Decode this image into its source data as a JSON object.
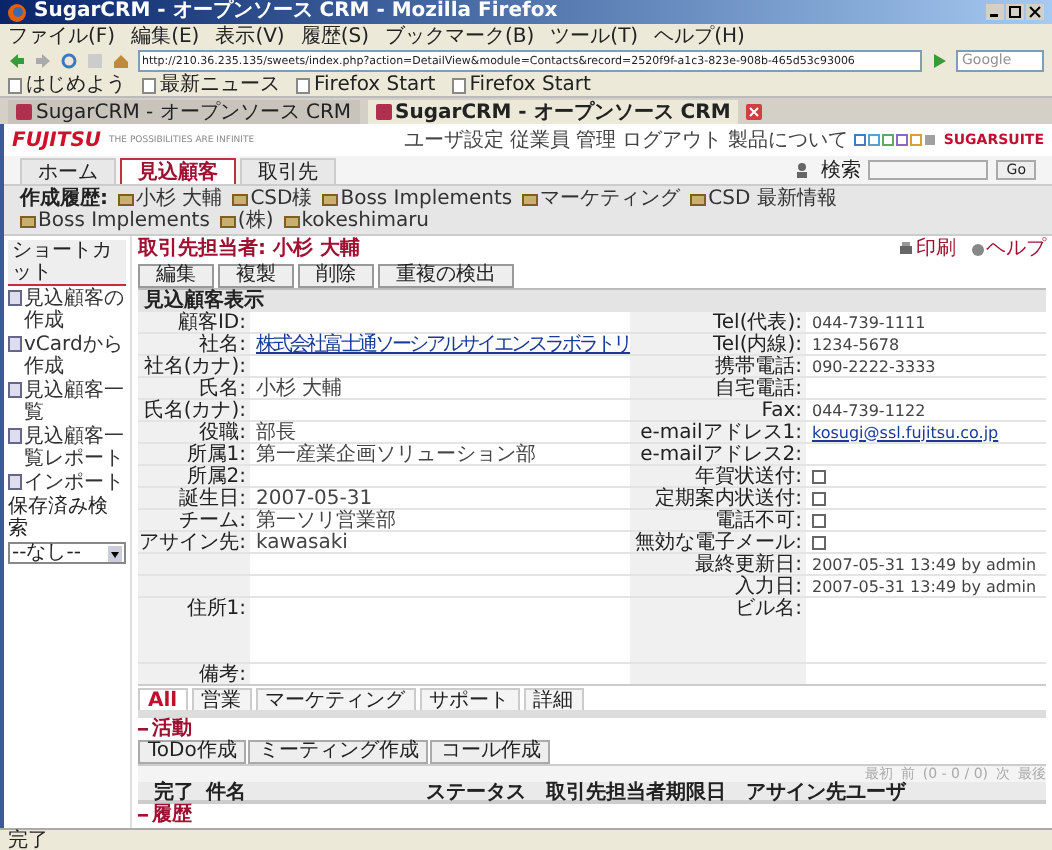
{
  "window": {
    "title": "SugarCRM - オープンソース CRM - Mozilla Firefox"
  },
  "menu": [
    "ファイル(F)",
    "編集(E)",
    "表示(V)",
    "履歴(S)",
    "ブックマーク(B)",
    "ツール(T)",
    "ヘルプ(H)"
  ],
  "address": "http://210.36.235.135/sweets/index.php?action=DetailView&module=Contacts&record=2520f9f-a1c3-823e-908b-465d53c93006",
  "search_box": {
    "placeholder": "Google"
  },
  "bookmarks": [
    "はじめよう",
    "最新ニュース",
    "Firefox Start",
    "Firefox Start"
  ],
  "browser_tabs": [
    {
      "label": "SugarCRM - オープンソース CRM",
      "selected": false
    },
    {
      "label": "SugarCRM - オープンソース CRM",
      "selected": true
    }
  ],
  "header": {
    "logo": "FUJITSU",
    "tagline": "THE POSSIBILITIES ARE INFINITE",
    "links": [
      "ユーザ設定",
      "従業員",
      "管理",
      "ログアウト",
      "製品について"
    ],
    "brand": "SUGARSUITE",
    "search_label": "検索",
    "search_button": "Go"
  },
  "module_tabs": [
    {
      "label": "ホーム",
      "selected": false
    },
    {
      "label": "見込顧客",
      "selected": true
    },
    {
      "label": "取引先",
      "selected": false
    }
  ],
  "recent": {
    "label": "作成履歴:",
    "items": [
      "小杉 大輔",
      "CSD様",
      "Boss Implements",
      "マーケティング",
      "CSD 最新情報",
      "Boss Implements",
      "(株)",
      "kokeshimaru"
    ]
  },
  "sidebar": {
    "title": "ショートカット",
    "items": [
      "見込顧客の作成",
      "vCardから作成",
      "見込顧客一覧",
      "見込顧客一覧レポート",
      "インポート"
    ],
    "saved_search_label": "保存済み検索",
    "saved_search_value": "--なし--"
  },
  "detail": {
    "title": "取引先担当者: 小杉 大輔",
    "actions": [
      "印刷",
      "ヘルプ"
    ],
    "buttons": [
      "編集",
      "複製",
      "削除",
      "重複の検出"
    ],
    "section": "見込顧客表示",
    "rows": [
      {
        "left": {
          "label": "顧客ID:"
        },
        "right": {
          "label": "Tel(代表):",
          "value": "044-739-1111"
        }
      },
      {
        "left": {
          "label": "社名:",
          "value": "株式会社富士通ソーシアルサイエンスラボラトリ",
          "kind": "link"
        },
        "right": {
          "label": "Tel(内線):",
          "value": "1234-5678"
        }
      },
      {
        "left": {
          "label": "社名(カナ):"
        },
        "right": {
          "label": "携帯電話:",
          "value": "090-2222-3333"
        }
      },
      {
        "left": {
          "label": "氏名:",
          "value": "小杉 大輔"
        },
        "right": {
          "label": "自宅電話:"
        }
      },
      {
        "left": {
          "label": "氏名(カナ):"
        },
        "right": {
          "label": "Fax:",
          "value": "044-739-1122"
        }
      },
      {
        "left": {
          "label": "役職:",
          "value": "部長"
        },
        "right": {
          "label": "e-mailアドレス1:",
          "value": "kosugi@ssl.fujitsu.co.jp",
          "kind": "link"
        }
      },
      {
        "left": {
          "label": "所属1:",
          "value": "第一産業企画ソリューション部"
        },
        "right": {
          "label": "e-mailアドレス2:"
        }
      },
      {
        "left": {
          "label": "所属2:"
        },
        "right": {
          "label": "年賀状送付:",
          "kind": "checkbox",
          "checked": false
        }
      },
      {
        "left": {
          "label": "誕生日:",
          "value": "2007-05-31"
        },
        "right": {
          "label": "定期案内状送付:",
          "kind": "checkbox",
          "checked": false
        }
      },
      {
        "left": {
          "label": "チーム:",
          "value": "第一ソリ営業部"
        },
        "right": {
          "label": "電話不可:",
          "kind": "checkbox",
          "checked": false
        }
      },
      {
        "left": {
          "label": "アサイン先:",
          "value": "kawasaki"
        },
        "right": {
          "label": "無効な電子メール:",
          "kind": "checkbox",
          "checked": false
        }
      },
      {
        "right": {
          "label": "最終更新日:",
          "value": "2007-05-31 13:49 by admin"
        }
      },
      {
        "right": {
          "label": "入力日:",
          "value": "2007-05-31 13:49 by admin"
        }
      },
      {
        "left": {
          "label": "住所1:"
        },
        "right": {
          "label": "ビル名:"
        },
        "tall": true
      },
      {
        "left": {
          "label": "備考:"
        }
      }
    ]
  },
  "subpanel_tabs": [
    {
      "label": "All",
      "selected": true
    },
    {
      "label": "営業",
      "selected": false
    },
    {
      "label": "マーケティング",
      "selected": false
    },
    {
      "label": "サポート",
      "selected": false
    },
    {
      "label": "詳細",
      "selected": false
    }
  ],
  "activities": {
    "title": "活動",
    "buttons": [
      "ToDo作成",
      "ミーティング作成",
      "コール作成"
    ],
    "pagination": [
      "最初",
      "前",
      "(0 - 0 / 0)",
      "次",
      "最後"
    ],
    "columns": [
      "完了",
      "件名",
      "ステータス",
      "取引先担当者",
      "期限日",
      "アサイン先ユーザ"
    ]
  },
  "history": {
    "title": "履歴"
  },
  "status_bar": "完了"
}
